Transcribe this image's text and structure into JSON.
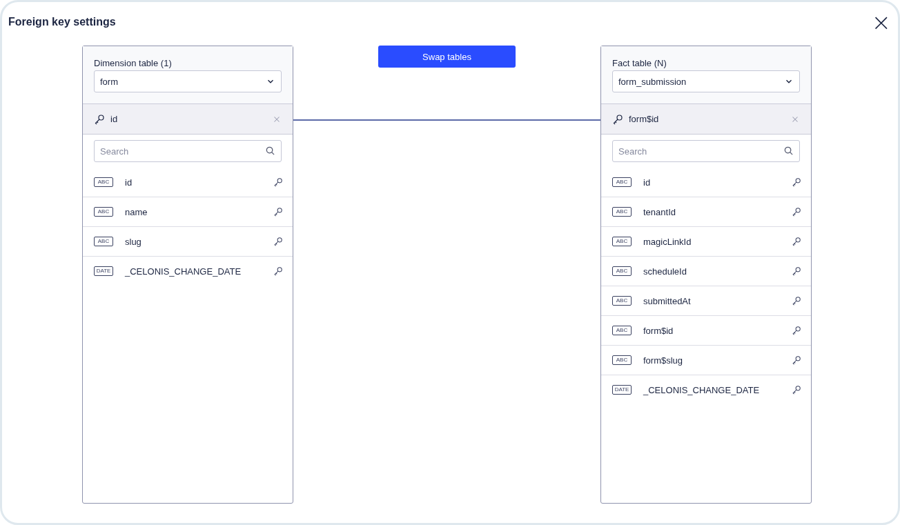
{
  "dialog": {
    "title": "Foreign key settings",
    "close": "×"
  },
  "swap_button": "Swap tables",
  "panels": [
    {
      "label": "Dimension table (1)",
      "table": "form",
      "key": "id",
      "search": {
        "placeholder": "Search"
      },
      "columns": [
        {
          "type": "ABC",
          "name": "id"
        },
        {
          "type": "ABC",
          "name": "name"
        },
        {
          "type": "ABC",
          "name": "slug"
        },
        {
          "type": "DATE",
          "name": "_CELONIS_CHANGE_DATE"
        }
      ]
    },
    {
      "label": "Fact table (N)",
      "table": "form_submission",
      "key": "form$id",
      "search": {
        "placeholder": "Search"
      },
      "columns": [
        {
          "type": "ABC",
          "name": "id"
        },
        {
          "type": "ABC",
          "name": "tenantId"
        },
        {
          "type": "ABC",
          "name": "magicLinkId"
        },
        {
          "type": "ABC",
          "name": "scheduleId"
        },
        {
          "type": "ABC",
          "name": "submittedAt"
        },
        {
          "type": "ABC",
          "name": "form$id"
        },
        {
          "type": "ABC",
          "name": "form$slug"
        },
        {
          "type": "DATE",
          "name": "_CELONIS_CHANGE_DATE"
        }
      ]
    }
  ]
}
